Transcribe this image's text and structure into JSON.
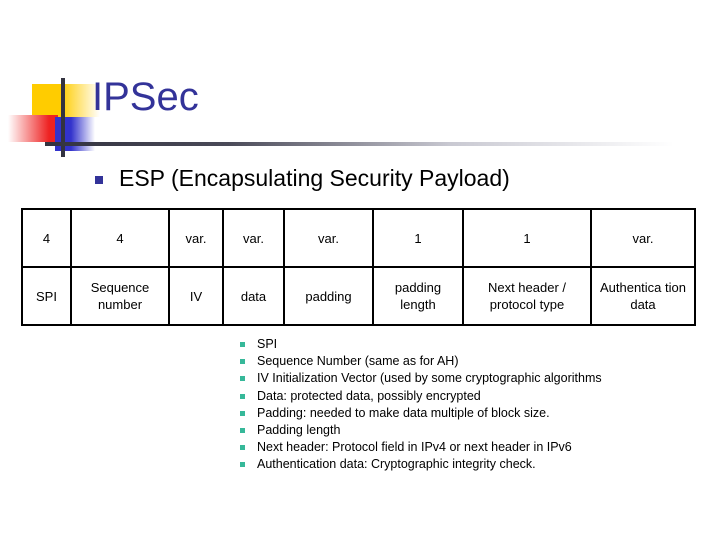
{
  "slide": {
    "title": "IPSec",
    "title_color": "#333399",
    "background": "#ffffff"
  },
  "decoration": {
    "yellow_color": "#FFCC00",
    "red_color": "#EE2222",
    "blue_color": "#3333CC",
    "line_color": "#333340"
  },
  "heading": {
    "bullet_color": "#333399",
    "text": "ESP (Encapsulating Security Payload)"
  },
  "table": {
    "columns": [
      {
        "size": "4",
        "name": "SPI"
      },
      {
        "size": "4",
        "name": "Sequence number"
      },
      {
        "size": "var.",
        "name": "IV"
      },
      {
        "size": "var.",
        "name": "data"
      },
      {
        "size": "var.",
        "name": "padding"
      },
      {
        "size": "1",
        "name": "padding length"
      },
      {
        "size": "1",
        "name": "Next header / protocol type"
      },
      {
        "size": "var.",
        "name": "Authentica tion data"
      }
    ]
  },
  "description": {
    "bullet_color": "#36B899",
    "items": [
      "SPI",
      "Sequence Number (same as for AH)",
      "IV Initialization Vector (used by some cryptographic algorithms",
      "Data: protected data, possibly encrypted",
      "Padding: needed to make data multiple of block size.",
      "Padding length",
      "Next header: Protocol field in IPv4 or next header in IPv6",
      "Authentication data: Cryptographic integrity check."
    ]
  }
}
